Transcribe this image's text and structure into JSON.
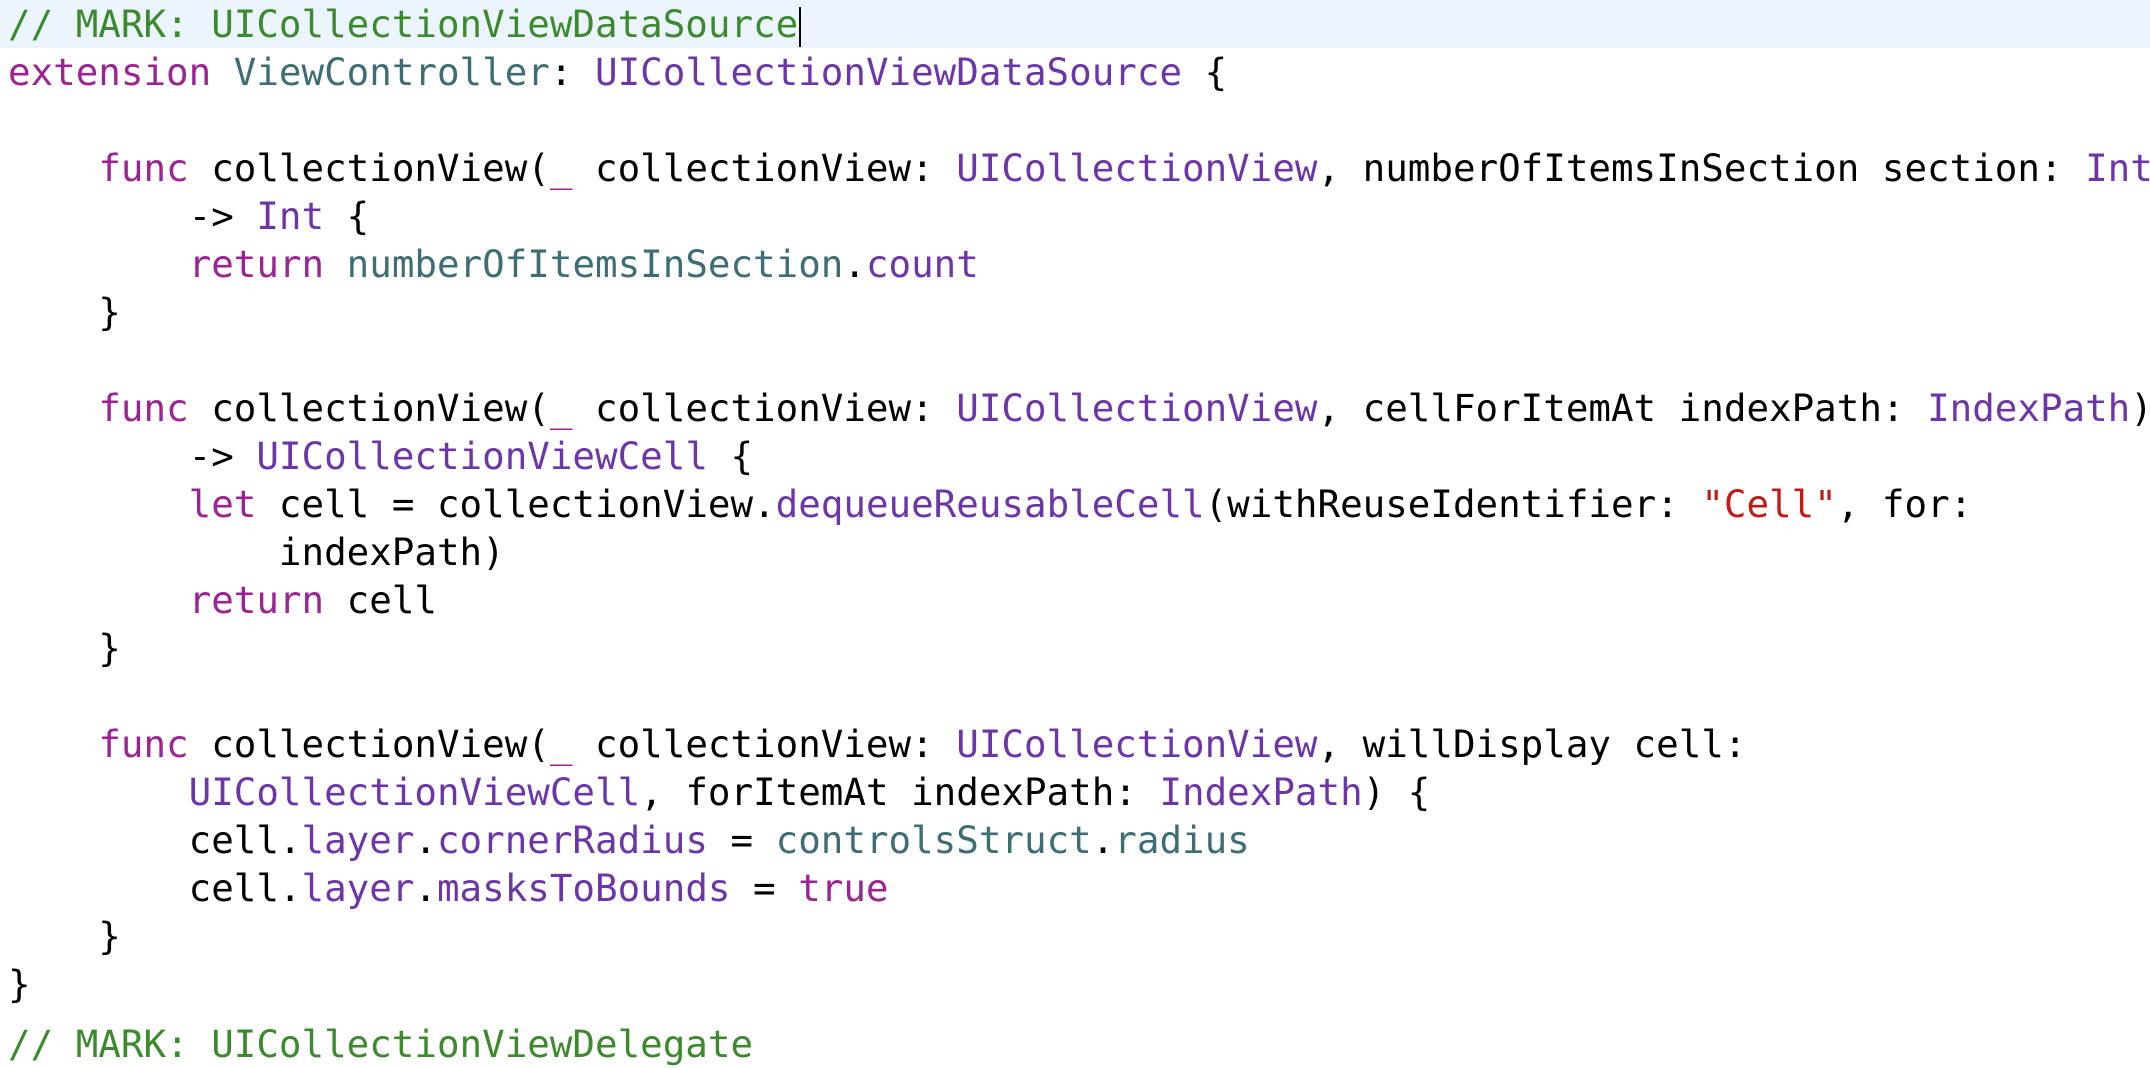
{
  "colors": {
    "comment": "#3c8a2e",
    "keyword": "#9b2393",
    "project_name": "#3e6d74",
    "system_name": "#6c36a9",
    "string": "#c41a16",
    "plain": "#000000",
    "current_line_bg": "#ecf5fe"
  },
  "lines": [
    [
      [
        "comment",
        "// MARK: UICollectionViewDataSource"
      ]
    ],
    [
      [
        "keyword",
        "extension"
      ],
      [
        "plain",
        " "
      ],
      [
        "project_name",
        "ViewController"
      ],
      [
        "plain",
        ": "
      ],
      [
        "system_name",
        "UICollectionViewDataSource"
      ],
      [
        "plain",
        " {"
      ]
    ],
    [],
    [
      [
        "plain",
        "    "
      ],
      [
        "keyword",
        "func"
      ],
      [
        "plain",
        " collectionView("
      ],
      [
        "keyword",
        "_"
      ],
      [
        "plain",
        " collectionView: "
      ],
      [
        "system_name",
        "UICollectionView"
      ],
      [
        "plain",
        ", numberOfItemsInSection section: "
      ],
      [
        "system_name",
        "Int"
      ],
      [
        "plain",
        ")"
      ]
    ],
    [
      [
        "plain",
        "        -> "
      ],
      [
        "system_name",
        "Int"
      ],
      [
        "plain",
        " {"
      ]
    ],
    [
      [
        "plain",
        "        "
      ],
      [
        "keyword",
        "return"
      ],
      [
        "plain",
        " "
      ],
      [
        "project_name",
        "numberOfItemsInSection"
      ],
      [
        "plain",
        "."
      ],
      [
        "system_name",
        "count"
      ]
    ],
    [
      [
        "plain",
        "    }"
      ]
    ],
    [],
    [
      [
        "plain",
        "    "
      ],
      [
        "keyword",
        "func"
      ],
      [
        "plain",
        " collectionView("
      ],
      [
        "keyword",
        "_"
      ],
      [
        "plain",
        " collectionView: "
      ],
      [
        "system_name",
        "UICollectionView"
      ],
      [
        "plain",
        ", cellForItemAt indexPath: "
      ],
      [
        "system_name",
        "IndexPath"
      ],
      [
        "plain",
        ")"
      ]
    ],
    [
      [
        "plain",
        "        -> "
      ],
      [
        "system_name",
        "UICollectionViewCell"
      ],
      [
        "plain",
        " {"
      ]
    ],
    [
      [
        "plain",
        "        "
      ],
      [
        "keyword",
        "let"
      ],
      [
        "plain",
        " cell = collectionView."
      ],
      [
        "system_name",
        "dequeueReusableCell"
      ],
      [
        "plain",
        "(withReuseIdentifier: "
      ],
      [
        "string",
        "\"Cell\""
      ],
      [
        "plain",
        ", for:"
      ]
    ],
    [
      [
        "plain",
        "            indexPath)"
      ]
    ],
    [
      [
        "plain",
        "        "
      ],
      [
        "keyword",
        "return"
      ],
      [
        "plain",
        " cell"
      ]
    ],
    [
      [
        "plain",
        "    }"
      ]
    ],
    [],
    [
      [
        "plain",
        "    "
      ],
      [
        "keyword",
        "func"
      ],
      [
        "plain",
        " collectionView("
      ],
      [
        "keyword",
        "_"
      ],
      [
        "plain",
        " collectionView: "
      ],
      [
        "system_name",
        "UICollectionView"
      ],
      [
        "plain",
        ", willDisplay cell:"
      ]
    ],
    [
      [
        "plain",
        "        "
      ],
      [
        "system_name",
        "UICollectionViewCell"
      ],
      [
        "plain",
        ", forItemAt indexPath: "
      ],
      [
        "system_name",
        "IndexPath"
      ],
      [
        "plain",
        ") {"
      ]
    ],
    [
      [
        "plain",
        "        cell."
      ],
      [
        "system_name",
        "layer"
      ],
      [
        "plain",
        "."
      ],
      [
        "system_name",
        "cornerRadius"
      ],
      [
        "plain",
        " = "
      ],
      [
        "project_name",
        "controlsStruct"
      ],
      [
        "plain",
        "."
      ],
      [
        "project_name",
        "radius"
      ]
    ],
    [
      [
        "plain",
        "        cell."
      ],
      [
        "system_name",
        "layer"
      ],
      [
        "plain",
        "."
      ],
      [
        "system_name",
        "masksToBounds"
      ],
      [
        "plain",
        " = "
      ],
      [
        "keyword",
        "true"
      ]
    ],
    [
      [
        "plain",
        "    }"
      ]
    ],
    [
      [
        "plain",
        "}"
      ]
    ]
  ],
  "clipped_line": [
    [
      "comment",
      "// MARK: UICollectionViewDelegate"
    ]
  ]
}
